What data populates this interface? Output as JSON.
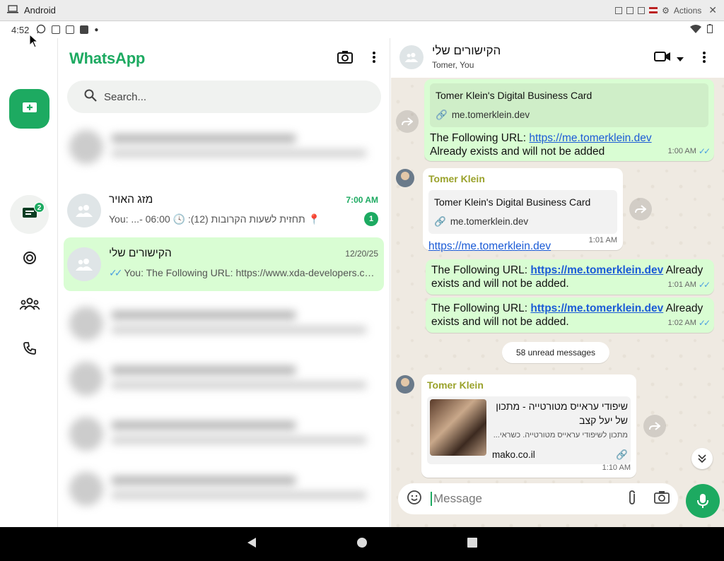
{
  "emulator": {
    "title": "Android",
    "actions_label": "Actions"
  },
  "status": {
    "time": "4:52"
  },
  "app": {
    "title": "WhatsApp"
  },
  "rail": {
    "chats_badge": "2"
  },
  "search": {
    "placeholder": "Search..."
  },
  "chats": [
    {
      "name": "מזג האויר",
      "time": "7:00 AM",
      "preview": "You: ...- 06:00 🕓 :(12) תחזית לשעות הקרובות 📍",
      "unread": "1"
    },
    {
      "name": "הקישורים שלי",
      "time": "12/20/25",
      "preview": "You: The Following URL: https://www.xda-developers.com..."
    }
  ],
  "conversation": {
    "name": "הקישורים שלי",
    "subtitle": "Tomer, You",
    "messages": [
      {
        "card_title": "Tomer Klein's Digital Business Card",
        "card_domain": "me.tomerklein.dev",
        "text_before": "The Following URL: ",
        "url": "https://me.tomerklein.dev",
        "text_after": " Already exists and will not be added",
        "time": "1:00 AM"
      },
      {
        "sender": "Tomer Klein",
        "card_title": "Tomer Klein's Digital Business Card",
        "card_domain": "me.tomerklein.dev",
        "url": "https://me.tomerklein.dev",
        "time": "1:01 AM"
      },
      {
        "text_before": "The Following URL: ",
        "url": "https://me.tomerklein.dev",
        "text_after": " Already exists and will not be added.",
        "time": "1:01 AM"
      },
      {
        "text_before": "The Following URL: ",
        "url": "https://me.tomerklein.dev",
        "text_after": " Already exists and will not be added.",
        "time": "1:02 AM"
      },
      {
        "sender": "Tomer Klein",
        "card_title": "שיפודי עראייס מטורטייה - מתכון של יעל קצב",
        "card_desc": "מתכון לשיפודי עראייס מטורטייה. כשראי...",
        "card_domain": "mako.co.il",
        "time": "1:10 AM"
      }
    ],
    "unread_label": "58 unread messages"
  },
  "compose": {
    "placeholder": "Message"
  },
  "colors": {
    "brand": "#1daa61",
    "outgoing": "#d9fdd3",
    "link": "#1b5bd6"
  }
}
